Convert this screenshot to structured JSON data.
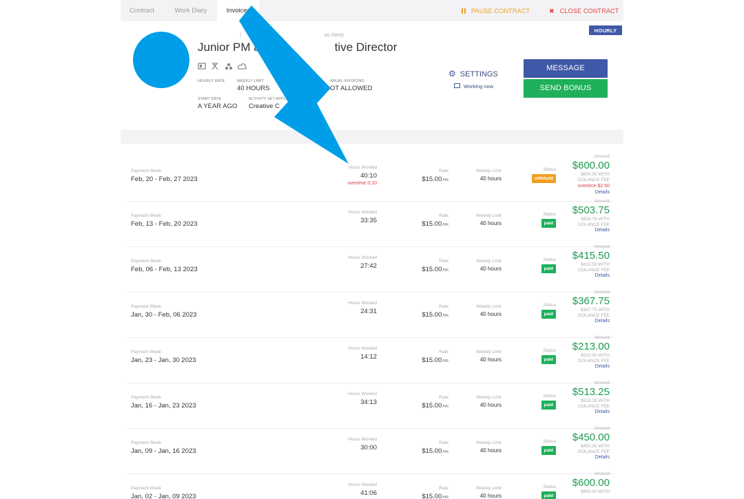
{
  "tabs": {
    "contract": "Contract",
    "work_diary": "Work Diary",
    "invoices": "Invoices"
  },
  "actions": {
    "pause": "PAUSE CONTRACT",
    "close": "CLOSE CONTRACT"
  },
  "badge": "HOURLY",
  "header": {
    "title": "Junior PM a",
    "title_end": "tive Director",
    "client_note_left": "(",
    "client_note": "as client)",
    "meta": {
      "hourly_rate_label": "HOURLY RATE",
      "weekly_limit_label": "WEEKLY LIMIT",
      "weekly_limit_value": "40 HOURS",
      "manual_invoicing_label": "ANUAL INVOICING",
      "manual_invoicing_value": "OT ALLOWED",
      "start_date_label": "START DATE",
      "start_date_value": "A YEAR AGO",
      "activity_label": "ACTIVITY SET APPLI",
      "activity_value": "Creative C"
    },
    "settings_label": "SETTINGS",
    "working_now": "Working now",
    "message_button": "MESSAGE",
    "bonus_button": "SEND BONUS"
  },
  "labels": {
    "payment_week": "Payment Week",
    "hours_worked": "Hours Worked",
    "rate": "Rate",
    "weekly_limit": "Weekly Limit",
    "status": "Status",
    "amount": "Amount",
    "details": "Details",
    "hr_unit": "/HR"
  },
  "invoices": [
    {
      "week": "Feb, 20 - Feb, 27 2023",
      "hours": "40:10",
      "overtime": "overtime 0:10",
      "rate": "$15.00",
      "limit": "40 hours",
      "status": "withhold",
      "amount": "$600.00",
      "fee_line1": "$600.00 WITH",
      "fee_line2": "GOLANCE FEE",
      "overtime_amount": "overtime $2.50"
    },
    {
      "week": "Feb, 13 - Feb, 20 2023",
      "hours": "33:35",
      "rate": "$15.00",
      "limit": "40 hours",
      "status": "paid",
      "amount": "$503.75",
      "fee_line1": "$503.75 WITH",
      "fee_line2": "GOLANCE FEE"
    },
    {
      "week": "Feb, 06 - Feb, 13 2023",
      "hours": "27:42",
      "rate": "$15.00",
      "limit": "40 hours",
      "status": "paid",
      "amount": "$415.50",
      "fee_line1": "$415.50 WITH",
      "fee_line2": "GOLANCE FEE"
    },
    {
      "week": "Jan, 30 - Feb, 06 2023",
      "hours": "24:31",
      "rate": "$15.00",
      "limit": "40 hours",
      "status": "paid",
      "amount": "$367.75",
      "fee_line1": "$367.75 WITH",
      "fee_line2": "GOLANCE FEE"
    },
    {
      "week": "Jan, 23 - Jan, 30 2023",
      "hours": "14:12",
      "rate": "$15.00",
      "limit": "40 hours",
      "status": "paid",
      "amount": "$213.00",
      "fee_line1": "$213.00 WITH",
      "fee_line2": "GOLANCE FEE"
    },
    {
      "week": "Jan, 16 - Jan, 23 2023",
      "hours": "34:13",
      "rate": "$15.00",
      "limit": "40 hours",
      "status": "paid",
      "amount": "$513.25",
      "fee_line1": "$513.25 WITH",
      "fee_line2": "GOLANCE FEE"
    },
    {
      "week": "Jan, 09 - Jan, 16 2023",
      "hours": "30:00",
      "rate": "$15.00",
      "limit": "40 hours",
      "status": "paid",
      "amount": "$450.00",
      "fee_line1": "$450.00 WITH",
      "fee_line2": "GOLANCE FEE"
    },
    {
      "week": "Jan, 02 - Jan, 09 2023",
      "hours": "41:06",
      "rate": "$15.00",
      "limit": "40 hours",
      "status": "paid",
      "amount": "$600.00",
      "fee_line1": "$600.00 WITH",
      "fee_line2": ""
    }
  ],
  "colors": {
    "accent_blue": "#3f58a7",
    "green": "#1eb05a",
    "amount_green": "#1e9a4f",
    "orange": "#f0a020",
    "red": "#e04040",
    "arrow": "#009ee8"
  }
}
